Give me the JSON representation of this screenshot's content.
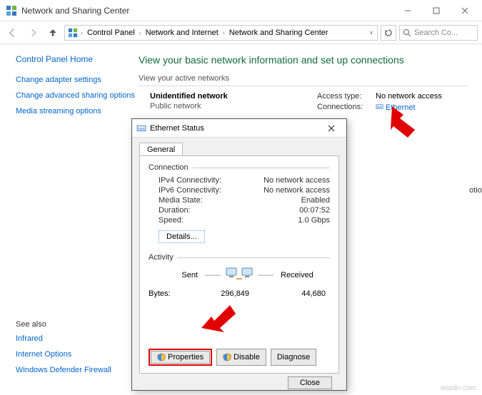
{
  "window": {
    "title": "Network and Sharing Center"
  },
  "breadcrumb": {
    "seg1": "Control Panel",
    "seg2": "Network and Internet",
    "seg3": "Network and Sharing Center"
  },
  "search": {
    "placeholder": "Search Co..."
  },
  "sidebar": {
    "home": "Control Panel Home",
    "links": [
      "Change adapter settings",
      "Change advanced sharing options",
      "Media streaming options"
    ],
    "seealso_hdr": "See also",
    "seealso": [
      "Infrared",
      "Internet Options",
      "Windows Defender Firewall"
    ]
  },
  "content": {
    "heading": "View your basic network information and set up connections",
    "subheading": "View your active networks",
    "network_name": "Unidentified network",
    "network_type": "Public network",
    "access_label": "Access type:",
    "access_value": "No network access",
    "conn_label": "Connections:",
    "conn_value": "Ethernet",
    "option_trail": "otion"
  },
  "dialog": {
    "title": "Ethernet Status",
    "tab": "General",
    "group_conn": "Connection",
    "stats": {
      "ipv4_k": "IPv4 Connectivity:",
      "ipv4_v": "No network access",
      "ipv6_k": "IPv6 Connectivity:",
      "ipv6_v": "No network access",
      "media_k": "Media State:",
      "media_v": "Enabled",
      "dur_k": "Duration:",
      "dur_v": "00:07:52",
      "speed_k": "Speed:",
      "speed_v": "1.0 Gbps"
    },
    "details_btn": "Details...",
    "group_act": "Activity",
    "sent": "Sent",
    "received": "Received",
    "bytes_label": "Bytes:",
    "bytes_sent": "296,849",
    "bytes_recv": "44,680",
    "props_btn": "Properties",
    "disable_btn": "Disable",
    "diagnose_btn": "Diagnose",
    "close_btn": "Close"
  },
  "watermark": "wsxdn.com"
}
